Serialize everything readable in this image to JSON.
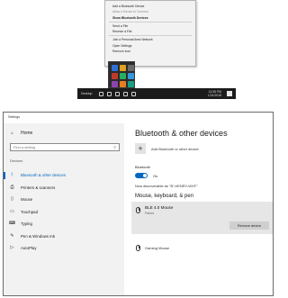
{
  "context_menu": {
    "items": [
      {
        "label": "Add a Bluetooth Device",
        "style": "normal"
      },
      {
        "label": "Allow a Device to Connect",
        "style": "dim"
      },
      {
        "label": "Show Bluetooth Devices",
        "style": "bold"
      },
      {
        "label": "Send a File",
        "style": "normal"
      },
      {
        "label": "Receive a File",
        "style": "normal"
      },
      {
        "label": "Join a Personal Area Network",
        "style": "normal"
      },
      {
        "label": "Open Settings",
        "style": "normal"
      },
      {
        "label": "Remove Icon",
        "style": "normal"
      }
    ]
  },
  "tray_overflow": {
    "icons": [
      {
        "name": "bluetooth-tray-icon",
        "color": "#2f6fd6"
      },
      {
        "name": "tray-app-icon-1",
        "color": "#e0a020"
      },
      {
        "name": "tray-app-icon-2",
        "color": "#6a6a6a"
      },
      {
        "name": "tray-app-icon-3",
        "color": "#c0392b"
      },
      {
        "name": "tray-app-icon-4",
        "color": "#27ae60"
      },
      {
        "name": "tray-app-icon-5",
        "color": "#3498db"
      },
      {
        "name": "tray-app-icon-6",
        "color": "#8e44ad"
      },
      {
        "name": "tray-app-icon-7",
        "color": "#e67e22"
      },
      {
        "name": "tray-app-icon-8",
        "color": "#16a085"
      }
    ]
  },
  "taskbar": {
    "left_text": "Desktop",
    "clock_time": "12:55 PM",
    "clock_date": "1/31/2018"
  },
  "settings": {
    "window_title": "Settings",
    "sidebar": {
      "home": "Home",
      "search_placeholder": "Find a setting",
      "section": "Devices",
      "items": [
        {
          "label": "Bluetooth & other devices",
          "icon": "bluetooth-icon",
          "glyph": "ᛒ",
          "active": true
        },
        {
          "label": "Printers & scanners",
          "icon": "printer-icon",
          "glyph": "⎙",
          "active": false
        },
        {
          "label": "Mouse",
          "icon": "mouse-icon",
          "glyph": "▯",
          "active": false
        },
        {
          "label": "Touchpad",
          "icon": "touchpad-icon",
          "glyph": "▭",
          "active": false
        },
        {
          "label": "Typing",
          "icon": "keyboard-icon",
          "glyph": "⌨",
          "active": false
        },
        {
          "label": "Pen & Windows Ink",
          "icon": "pen-icon",
          "glyph": "✎",
          "active": false
        },
        {
          "label": "AutoPlay",
          "icon": "autoplay-icon",
          "glyph": "▷",
          "active": false
        }
      ]
    },
    "content": {
      "title": "Bluetooth & other devices",
      "add_device_label": "Add Bluetooth or other device",
      "bluetooth_label": "Bluetooth",
      "toggle_state": "On",
      "discoverable_text": "Now discoverable as \"B’-HENRY-WXF\"",
      "section_heading": "Mouse, keyboard, & pen",
      "devices": [
        {
          "name": "BLE 4.0 Mouse",
          "status": "Paired"
        },
        {
          "name": "Gaming Mouse",
          "status": ""
        }
      ],
      "remove_button": "Remove device"
    }
  },
  "colors": {
    "accent": "#0067c0",
    "sidebar_bg": "#f2f2f2",
    "taskbar_bg": "#1b1b1b"
  }
}
